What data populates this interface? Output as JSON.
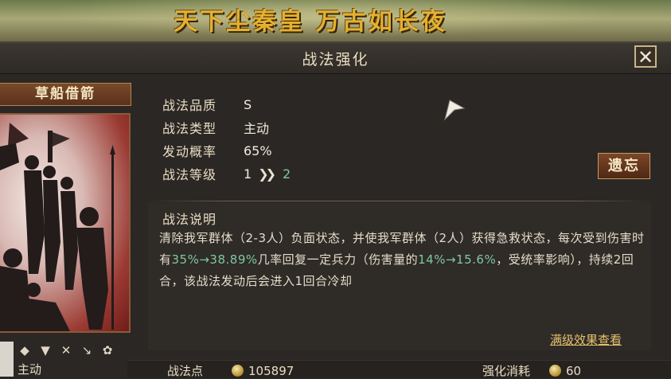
{
  "banner": {
    "title": "天下尘秦皇 万古如长夜"
  },
  "window": {
    "title": "战法强化",
    "close_label": "✕"
  },
  "skill": {
    "name": "草船借箭",
    "type_icons": [
      "◆",
      "▼",
      "✕",
      "↘",
      "✿"
    ],
    "type_label": "主动"
  },
  "stats": [
    {
      "label": "战法品质",
      "value": "S"
    },
    {
      "label": "战法类型",
      "value": "主动"
    },
    {
      "label": "发动概率",
      "value": "65%"
    }
  ],
  "level": {
    "label": "战法等级",
    "current": "1",
    "next": "2"
  },
  "legacy_button": "遗忘",
  "description": {
    "heading": "战法说明",
    "part1": "清除我军群体（2-3人）负面状态，并使我军群体（2人）获得急救状态，每次受到伤害时有",
    "hl1": "35%→38.89%",
    "part2": "几率回复一定兵力（伤害量的",
    "hl2": "14%→15.6%",
    "part3": "，受统率影响），持续2回合，该战法发动后会进入1回合冷却"
  },
  "full_effect_link": "满级效果查看",
  "bottom": {
    "points_label": "战法点",
    "points_value": "105897",
    "cost_label": "强化消耗",
    "cost_value": "60"
  },
  "colors": {
    "accent_gold": "#e3b132",
    "highlight_green": "#7fc8a0",
    "link": "#e7c26c"
  }
}
